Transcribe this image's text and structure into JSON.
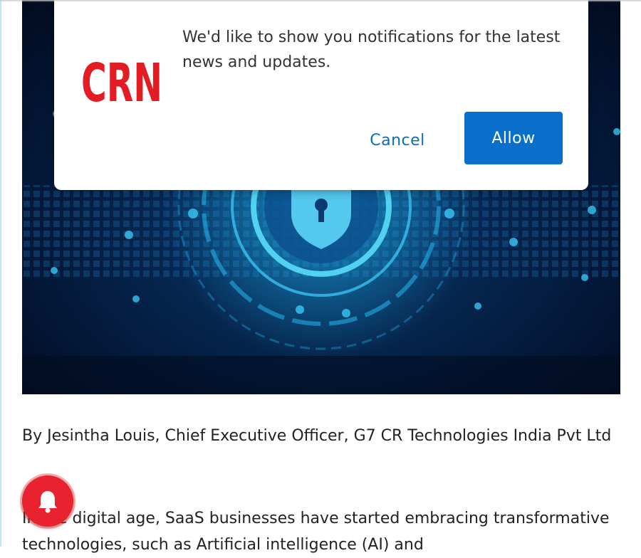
{
  "notification_prompt": {
    "logo_text": "CRN",
    "message": "We'd like to show you notifications for the latest news and updates.",
    "cancel_label": "Cancel",
    "allow_label": "Allow"
  },
  "article": {
    "byline": "By Jesintha Louis, Chief Executive Officer, G7 CR Technologies India Pvt Ltd",
    "first_paragraph": "In the digital age, SaaS businesses have started embracing transformative technologies, such as Artificial intelligence (AI) and"
  },
  "icons": {
    "shield": "shield-lock-icon",
    "bell": "bell-icon"
  },
  "colors": {
    "allow_button": "#0a6fcb",
    "cancel_text": "#0a6ebd",
    "bell_badge": "#e8232f",
    "crn_logo": "#e31b23"
  }
}
